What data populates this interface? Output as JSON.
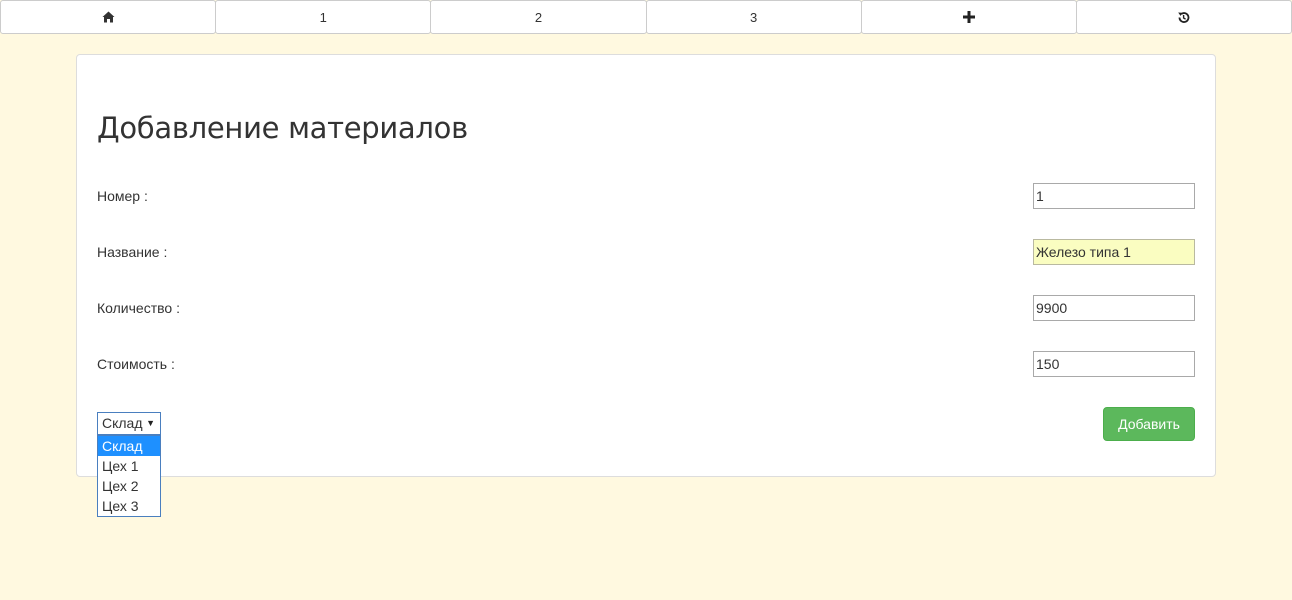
{
  "nav": {
    "items": [
      {
        "label": "",
        "icon": "home-icon"
      },
      {
        "label": "1"
      },
      {
        "label": "2"
      },
      {
        "label": "3"
      },
      {
        "label": "",
        "icon": "plus-icon"
      },
      {
        "label": "",
        "icon": "history-icon"
      }
    ]
  },
  "form": {
    "title": "Добавление материалов",
    "number_label": "Номер :",
    "number_value": "1",
    "name_label": "Название :",
    "name_value": "Железо типа 1",
    "quantity_label": "Количество :",
    "quantity_value": "9900",
    "cost_label": "Стоимость :",
    "cost_value": "150",
    "location_selected": "Склад",
    "location_options": [
      "Склад",
      "Цех 1",
      "Цех 2",
      "Цех 3"
    ],
    "add_button": "Добавить"
  },
  "colors": {
    "page_background": "#fff9e0",
    "add_button": "#5cb85c",
    "autofill_field": "#fafdc1",
    "selected_option": "#1e90ff"
  }
}
